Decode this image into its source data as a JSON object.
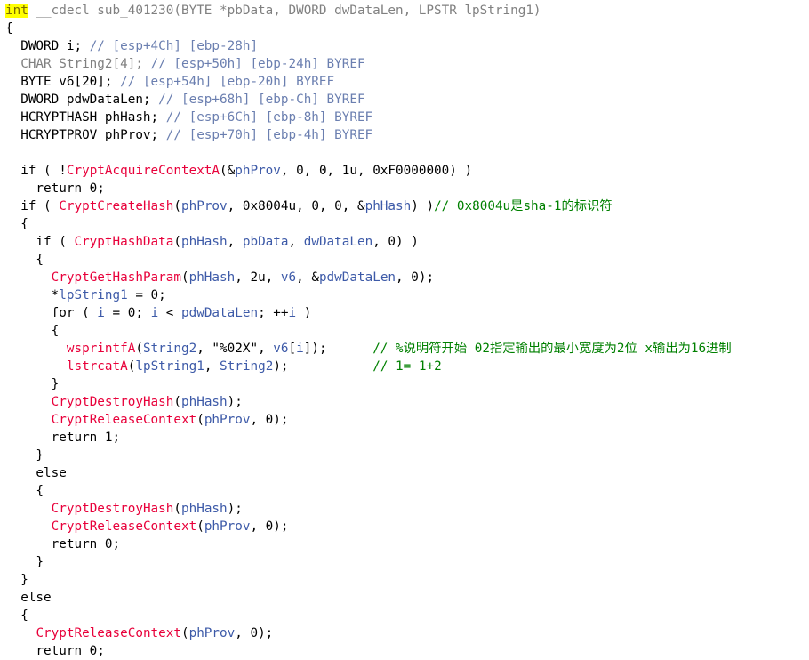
{
  "colors": {
    "keyword": "#000000",
    "function": "#e8003a",
    "variable": "#3d5aa8",
    "comment": "#008000",
    "stack_comment": "#6b7fb0",
    "highlight": "#ffff00"
  },
  "lines": [
    [
      [
        "hl",
        "int"
      ],
      [
        "plain",
        " "
      ],
      [
        "gray",
        "__cdecl sub_401230(BYTE *pbData, DWORD dwDataLen, LPSTR lpString1)"
      ]
    ],
    [
      [
        "plain",
        "{"
      ]
    ],
    [
      [
        "plain",
        "  DWORD i; "
      ],
      [
        "stk",
        "// [esp+4Ch] [ebp-28h]"
      ]
    ],
    [
      [
        "gray",
        "  CHAR String2[4]; "
      ],
      [
        "stk",
        "// [esp+50h] [ebp-24h] BYREF"
      ]
    ],
    [
      [
        "plain",
        "  BYTE v6[20]; "
      ],
      [
        "stk",
        "// [esp+54h] [ebp-20h] BYREF"
      ]
    ],
    [
      [
        "plain",
        "  DWORD pdwDataLen; "
      ],
      [
        "stk",
        "// [esp+68h] [ebp-Ch] BYREF"
      ]
    ],
    [
      [
        "plain",
        "  HCRYPTHASH phHash; "
      ],
      [
        "stk",
        "// [esp+6Ch] [ebp-8h] BYREF"
      ]
    ],
    [
      [
        "plain",
        "  HCRYPTPROV phProv; "
      ],
      [
        "stk",
        "// [esp+70h] [ebp-4h] BYREF"
      ]
    ],
    [
      [
        "plain",
        ""
      ]
    ],
    [
      [
        "plain",
        "  if ( !"
      ],
      [
        "func",
        "CryptAcquireContextA"
      ],
      [
        "plain",
        "(&"
      ],
      [
        "var",
        "phProv"
      ],
      [
        "plain",
        ", 0, 0, 1u, 0xF0000000) )"
      ]
    ],
    [
      [
        "plain",
        "    return 0;"
      ]
    ],
    [
      [
        "plain",
        "  if ( "
      ],
      [
        "func",
        "CryptCreateHash"
      ],
      [
        "plain",
        "("
      ],
      [
        "var",
        "phProv"
      ],
      [
        "plain",
        ", 0x8004u, 0, 0, &"
      ],
      [
        "var",
        "phHash"
      ],
      [
        "plain",
        ") )"
      ],
      [
        "cm",
        "// 0x8004u是sha-1的标识符"
      ]
    ],
    [
      [
        "plain",
        "  {"
      ]
    ],
    [
      [
        "plain",
        "    if ( "
      ],
      [
        "func",
        "CryptHashData"
      ],
      [
        "plain",
        "("
      ],
      [
        "var",
        "phHash"
      ],
      [
        "plain",
        ", "
      ],
      [
        "var",
        "pbData"
      ],
      [
        "plain",
        ", "
      ],
      [
        "var",
        "dwDataLen"
      ],
      [
        "plain",
        ", 0) )"
      ]
    ],
    [
      [
        "plain",
        "    {"
      ]
    ],
    [
      [
        "plain",
        "      "
      ],
      [
        "func",
        "CryptGetHashParam"
      ],
      [
        "plain",
        "("
      ],
      [
        "var",
        "phHash"
      ],
      [
        "plain",
        ", 2u, "
      ],
      [
        "var",
        "v6"
      ],
      [
        "plain",
        ", &"
      ],
      [
        "var",
        "pdwDataLen"
      ],
      [
        "plain",
        ", 0);"
      ]
    ],
    [
      [
        "plain",
        "      *"
      ],
      [
        "var",
        "lpString1"
      ],
      [
        "plain",
        " = 0;"
      ]
    ],
    [
      [
        "plain",
        "      for ( "
      ],
      [
        "var",
        "i"
      ],
      [
        "plain",
        " = 0; "
      ],
      [
        "var",
        "i"
      ],
      [
        "plain",
        " < "
      ],
      [
        "var",
        "pdwDataLen"
      ],
      [
        "plain",
        "; ++"
      ],
      [
        "var",
        "i"
      ],
      [
        "plain",
        " )"
      ]
    ],
    [
      [
        "plain",
        "      {"
      ]
    ],
    [
      [
        "plain",
        "        "
      ],
      [
        "func",
        "wsprintfA"
      ],
      [
        "plain",
        "("
      ],
      [
        "var",
        "String2"
      ],
      [
        "plain",
        ", \"%02X\", "
      ],
      [
        "var",
        "v6"
      ],
      [
        "plain",
        "["
      ],
      [
        "var",
        "i"
      ],
      [
        "plain",
        "]);      "
      ],
      [
        "cm",
        "// %说明符开始 02指定输出的最小宽度为2位 x输出为16进制"
      ]
    ],
    [
      [
        "plain",
        "        "
      ],
      [
        "func",
        "lstrcatA"
      ],
      [
        "plain",
        "("
      ],
      [
        "var",
        "lpString1"
      ],
      [
        "plain",
        ", "
      ],
      [
        "var",
        "String2"
      ],
      [
        "plain",
        ");           "
      ],
      [
        "cm",
        "// 1= 1+2"
      ]
    ],
    [
      [
        "plain",
        "      }"
      ]
    ],
    [
      [
        "plain",
        "      "
      ],
      [
        "func",
        "CryptDestroyHash"
      ],
      [
        "plain",
        "("
      ],
      [
        "var",
        "phHash"
      ],
      [
        "plain",
        ");"
      ]
    ],
    [
      [
        "plain",
        "      "
      ],
      [
        "func",
        "CryptReleaseContext"
      ],
      [
        "plain",
        "("
      ],
      [
        "var",
        "phProv"
      ],
      [
        "plain",
        ", 0);"
      ]
    ],
    [
      [
        "plain",
        "      return 1;"
      ]
    ],
    [
      [
        "plain",
        "    }"
      ]
    ],
    [
      [
        "plain",
        "    else"
      ]
    ],
    [
      [
        "plain",
        "    {"
      ]
    ],
    [
      [
        "plain",
        "      "
      ],
      [
        "func",
        "CryptDestroyHash"
      ],
      [
        "plain",
        "("
      ],
      [
        "var",
        "phHash"
      ],
      [
        "plain",
        ");"
      ]
    ],
    [
      [
        "plain",
        "      "
      ],
      [
        "func",
        "CryptReleaseContext"
      ],
      [
        "plain",
        "("
      ],
      [
        "var",
        "phProv"
      ],
      [
        "plain",
        ", 0);"
      ]
    ],
    [
      [
        "plain",
        "      return 0;"
      ]
    ],
    [
      [
        "plain",
        "    }"
      ]
    ],
    [
      [
        "plain",
        "  }"
      ]
    ],
    [
      [
        "plain",
        "  else"
      ]
    ],
    [
      [
        "plain",
        "  {"
      ]
    ],
    [
      [
        "plain",
        "    "
      ],
      [
        "func",
        "CryptReleaseContext"
      ],
      [
        "plain",
        "("
      ],
      [
        "var",
        "phProv"
      ],
      [
        "plain",
        ", 0);"
      ]
    ],
    [
      [
        "plain",
        "    return 0;"
      ]
    ]
  ]
}
